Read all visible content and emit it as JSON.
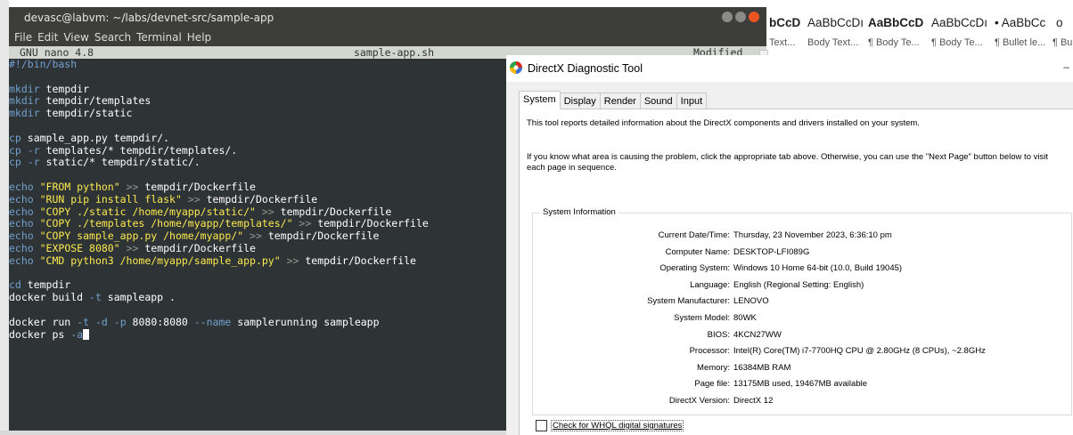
{
  "terminal": {
    "title": "devasc@labvm: ~/labs/devnet-src/sample-app",
    "menu": [
      "File",
      "Edit",
      "View",
      "Search",
      "Terminal",
      "Help"
    ],
    "nano": {
      "version": "GNU nano 4.8",
      "filename": "sample-app.sh",
      "status": "Modified"
    },
    "lines": [
      [
        {
          "t": "#!/bin/bash",
          "c": "blue"
        }
      ],
      [],
      [
        {
          "t": "mkdir",
          "c": "blue"
        },
        {
          "t": " tempdir",
          "c": "white"
        }
      ],
      [
        {
          "t": "mkdir",
          "c": "blue"
        },
        {
          "t": " tempdir/templates",
          "c": "white"
        }
      ],
      [
        {
          "t": "mkdir",
          "c": "blue"
        },
        {
          "t": " tempdir/static",
          "c": "white"
        }
      ],
      [],
      [
        {
          "t": "cp",
          "c": "blue"
        },
        {
          "t": " sample_app.py tempdir/.",
          "c": "white"
        }
      ],
      [
        {
          "t": "cp",
          "c": "blue"
        },
        {
          "t": " ",
          "c": "white"
        },
        {
          "t": "-r",
          "c": "blue"
        },
        {
          "t": " templates/* tempdir/templates/.",
          "c": "white"
        }
      ],
      [
        {
          "t": "cp",
          "c": "blue"
        },
        {
          "t": " ",
          "c": "white"
        },
        {
          "t": "-r",
          "c": "blue"
        },
        {
          "t": " static/* tempdir/static/.",
          "c": "white"
        }
      ],
      [],
      [
        {
          "t": "echo",
          "c": "blue"
        },
        {
          "t": " \"FROM python\"",
          "c": "yellow"
        },
        {
          "t": " >> ",
          "c": "gray"
        },
        {
          "t": "tempdir/Dockerfile",
          "c": "white"
        }
      ],
      [
        {
          "t": "echo",
          "c": "blue"
        },
        {
          "t": " \"RUN pip install flask\"",
          "c": "yellow"
        },
        {
          "t": " >> ",
          "c": "gray"
        },
        {
          "t": "tempdir/Dockerfile",
          "c": "white"
        }
      ],
      [
        {
          "t": "echo",
          "c": "blue"
        },
        {
          "t": " \"COPY ./static /home/myapp/static/\"",
          "c": "yellow"
        },
        {
          "t": " >> ",
          "c": "gray"
        },
        {
          "t": "tempdir/Dockerfile",
          "c": "white"
        }
      ],
      [
        {
          "t": "echo",
          "c": "blue"
        },
        {
          "t": " \"COPY ./templates /home/myapp/templates/\"",
          "c": "yellow"
        },
        {
          "t": " >> ",
          "c": "gray"
        },
        {
          "t": "tempdir/Dockerfile",
          "c": "white"
        }
      ],
      [
        {
          "t": "echo",
          "c": "blue"
        },
        {
          "t": " \"COPY sample_app.py /home/myapp/\"",
          "c": "yellow"
        },
        {
          "t": " >> ",
          "c": "gray"
        },
        {
          "t": "tempdir/Dockerfile",
          "c": "white"
        }
      ],
      [
        {
          "t": "echo",
          "c": "blue"
        },
        {
          "t": " \"EXPOSE 8080\"",
          "c": "yellow"
        },
        {
          "t": " >> ",
          "c": "gray"
        },
        {
          "t": "tempdir/Dockerfile",
          "c": "white"
        }
      ],
      [
        {
          "t": "echo",
          "c": "blue"
        },
        {
          "t": " \"CMD python3 /home/myapp/sample_app.py\"",
          "c": "yellow"
        },
        {
          "t": " >> ",
          "c": "gray"
        },
        {
          "t": "tempdir/Dockerfile",
          "c": "white"
        }
      ],
      [],
      [
        {
          "t": "cd",
          "c": "blue"
        },
        {
          "t": " tempdir",
          "c": "white"
        }
      ],
      [
        {
          "t": "docker build ",
          "c": "white"
        },
        {
          "t": "-t",
          "c": "blue"
        },
        {
          "t": " sampleapp .",
          "c": "white"
        }
      ],
      [],
      [
        {
          "t": "docker run ",
          "c": "white"
        },
        {
          "t": "-t",
          "c": "blue"
        },
        {
          "t": " ",
          "c": "white"
        },
        {
          "t": "-d",
          "c": "blue"
        },
        {
          "t": " ",
          "c": "white"
        },
        {
          "t": "-p",
          "c": "blue"
        },
        {
          "t": " 8080:8080 ",
          "c": "white"
        },
        {
          "t": "--name",
          "c": "blue"
        },
        {
          "t": " samplerunning sampleapp",
          "c": "white"
        }
      ],
      [
        {
          "t": "docker ps ",
          "c": "white"
        },
        {
          "t": "-a",
          "c": "blue"
        },
        {
          "cursor": true
        }
      ]
    ]
  },
  "ribbon": {
    "styles": [
      {
        "preview": "bCcD",
        "name": "Text...",
        "bold": true
      },
      {
        "preview": "AaBbCcDı",
        "name": "Body Text...",
        "bold": false
      },
      {
        "preview": "AaBbCcD",
        "name": "¶ Body Te...",
        "bold": true
      },
      {
        "preview": "AaBbCcDı",
        "name": "¶ Body Te...",
        "bold": false
      },
      {
        "preview": "• AaBbCc",
        "name": "¶ Bullet le...",
        "bold": false
      },
      {
        "preview": "o",
        "name": "¶ Bu",
        "bold": false
      }
    ]
  },
  "dxdiag": {
    "title": "DirectX Diagnostic Tool",
    "minimize_glyph": "–",
    "tabs": [
      "System",
      "Display",
      "Render",
      "Sound",
      "Input"
    ],
    "active_tab": "System",
    "intro1": "This tool reports detailed information about the DirectX components and drivers installed on your system.",
    "intro2": "If you know what area is causing the problem, click the appropriate tab above.  Otherwise, you can use the \"Next Page\" button below to visit each page in sequence.",
    "group_title": "System Information",
    "rows": [
      {
        "label": "Current Date/Time:",
        "value": "Thursday, 23 November 2023, 6:36:10 pm"
      },
      {
        "label": "Computer Name:",
        "value": "DESKTOP-LFI089G"
      },
      {
        "label": "Operating System:",
        "value": "Windows 10 Home 64-bit (10.0, Build 19045)"
      },
      {
        "label": "Language:",
        "value": "English (Regional Setting: English)"
      },
      {
        "label": "System Manufacturer:",
        "value": "LENOVO"
      },
      {
        "label": "System Model:",
        "value": "80WK"
      },
      {
        "label": "BIOS:",
        "value": "4KCN27WW"
      },
      {
        "label": "Processor:",
        "value": "Intel(R) Core(TM) i7-7700HQ CPU @ 2.80GHz (8 CPUs), ~2.8GHz"
      },
      {
        "label": "Memory:",
        "value": "16384MB RAM"
      },
      {
        "label": "Page file:",
        "value": "13175MB used, 19467MB available"
      },
      {
        "label": "DirectX Version:",
        "value": "DirectX 12"
      }
    ],
    "whql_label": "Check for WHQL digital signatures"
  }
}
